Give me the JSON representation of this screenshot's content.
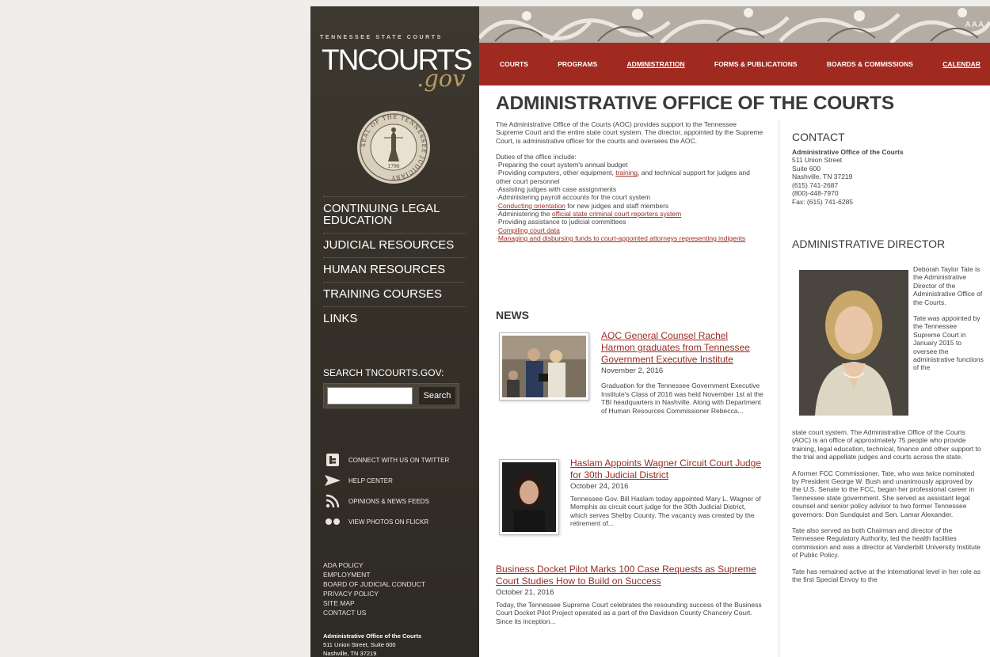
{
  "sidebar": {
    "kicker": "TENNESSEE STATE COURTS",
    "logo_main": "TNCOURTS",
    "logo_gov": ".gov",
    "seal_text": "SEAL OF THE TENNESSEE JUDICIARY",
    "seal_year": "1796",
    "nav": [
      {
        "label": "CONTINUING LEGAL EDUCATION"
      },
      {
        "label": "JUDICIAL RESOURCES"
      },
      {
        "label": "HUMAN RESOURCES"
      },
      {
        "label": "TRAINING COURSES"
      },
      {
        "label": "LINKS"
      }
    ],
    "search_label": "SEARCH TNCOURTS.GOV:",
    "search_button": "Search",
    "search_value": "",
    "social": [
      {
        "label": "CONNECT WITH US ON TWITTER",
        "icon": "twitter-icon"
      },
      {
        "label": "HELP CENTER",
        "icon": "arrow-icon"
      },
      {
        "label": "OPINIONS & NEWS FEEDS",
        "icon": "rss-icon"
      },
      {
        "label": "VIEW PHOTOS ON FLICKR",
        "icon": "flickr-icon"
      }
    ],
    "footer_links": [
      "ADA POLICY",
      "EMPLOYMENT",
      "BOARD OF JUDICIAL CONDUCT",
      "PRIVACY POLICY",
      "SITE MAP",
      "CONTACT US"
    ],
    "address": [
      "Administrative Office of the Courts",
      "511 Union Street, Suite 600",
      "Nashville, TN 37219"
    ]
  },
  "header": {
    "ada_text": "A A A",
    "nav": [
      {
        "label": "COURTS",
        "underline": false
      },
      {
        "label": "PROGRAMS",
        "underline": false
      },
      {
        "label": "ADMINISTRATION",
        "underline": true
      },
      {
        "label": "FORMS & PUBLICATIONS",
        "underline": false
      },
      {
        "label": "BOARDS & COMMISSIONS",
        "underline": false
      },
      {
        "label": "CALENDAR",
        "underline": true
      }
    ]
  },
  "main": {
    "title": "ADMINISTRATIVE OFFICE OF THE COURTS",
    "intro": "The Administrative Office of the Courts (AOC) provides support to the Tennessee Supreme Court and the entire state court system. The director, appointed by the Supreme Court, is administrative officer for the courts and oversees the AOC.",
    "duties_intro": "Duties of the office include:",
    "duties": {
      "d1": "·Preparing the court system's annual budget",
      "d2_pre": "·Providing computers, other equipment, ",
      "d2_link": "training",
      "d2_post": ", and technical support for judges and other court personnel",
      "d3": "·Assisting judges with case assignments",
      "d4": "·Administering payroll accounts for the court system",
      "d5_pre": "·",
      "d5_link": "Conducting orientation",
      "d5_post": " for new judges and staff members",
      "d6_pre": "·Administering the ",
      "d6_link": "official state criminal court reporters system",
      "d7": "·Providing assistance to judicial committees",
      "d8_pre": "·",
      "d8_link": "Compiling court data",
      "d9_pre": "·",
      "d9_link": "Managing and disbursing funds to court-appointed attorneys representing indigents"
    },
    "news_heading": "NEWS",
    "news": [
      {
        "title": "AOC General Counsel Rachel Harmon graduates from Tennessee Government Executive Institute",
        "date": "November 2, 2016",
        "body": "Graduation for the Tennessee Government Executive Institute's Class of 2016 was held November 1st at the TBI headquarters in Nashville. Along with Department of Human Resources Commissioner Rebecca..."
      },
      {
        "title": "Haslam Appoints Wagner Circuit Court Judge for 30th Judicial District",
        "date": "October 24, 2016",
        "body": "Tennessee Gov. Bill Haslam today appointed Mary L. Wagner of Memphis as circuit court judge for the 30th Judicial District, which serves Shelby County. The vacancy was created by the retirement of..."
      },
      {
        "title": "Business Docket Pilot Marks 100 Case Requests as Supreme Court Studies How to Build on Success",
        "date": "October 21, 2016",
        "body": "Today, the Tennessee Supreme Court celebrates the resounding success of the Business Court Docket Pilot Project operated as a part of the Davidson County Chancery Court.  Since its inception..."
      }
    ]
  },
  "contact": {
    "heading": "CONTACT",
    "org": "Administrative Office of the Courts",
    "lines": [
      "511 Union Street",
      "Suite 600",
      "Nashville, TN 37219",
      "(615) 741-2687",
      "(800)-448-7970",
      "Fax: (615) 741-6285"
    ]
  },
  "director": {
    "heading": "ADMINISTRATIVE DIRECTOR",
    "beside_1": "Deborah Taylor Tate is the Administrative Director of the Administrative Office of the Courts.",
    "beside_2": "Tate was appointed by the Tennessee Supreme Court in January 2015 to oversee the administrative functions of the",
    "cont": "state court system. The Administrative Office of the Courts (AOC) is an office of approximately 75 people who provide training, legal education, technical, finance and other support to the trial and appellate judges and courts across the state.",
    "p2": "A former FCC Commissioner, Tate, who was twice nominated by President George W. Bush and unanimously approved by the U.S. Senate to the FCC, began her professional career in Tennessee state government. She served as assistant legal counsel and senior policy advisor to two former Tennessee governors: Don Sundquist and Sen. Lamar Alexander.",
    "p3": "Tate also served as both Chairman and director of the Tennessee Regulatory Authority, led the health facilities commission and was a director at Vanderbilt University Institute of Public Policy.",
    "p4": "Tate has remained active at the international level in her role as the first Special Envoy to the"
  }
}
